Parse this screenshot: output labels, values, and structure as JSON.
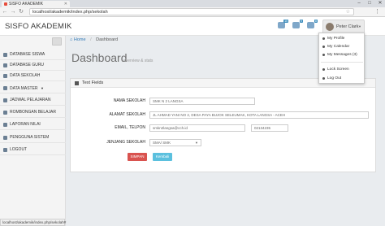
{
  "browser": {
    "tab_title": "SISFO AKADEMIK",
    "url": "localhost/akademik/index.php/sekolah",
    "status_url": "localhost/akademik/index.php/sekolah#"
  },
  "header": {
    "brand": "SISFO AKADEMIK",
    "notifications": [
      "10",
      "9",
      "8"
    ],
    "user_name": "Peter Clark"
  },
  "user_menu": {
    "items": [
      {
        "label": "My Profile",
        "icon": "user-icon"
      },
      {
        "label": "My Calendar",
        "icon": "calendar-icon"
      },
      {
        "label": "My Messages (3)",
        "icon": "envelope-icon"
      },
      {
        "label": "Lock Screen",
        "icon": "lock-icon"
      },
      {
        "label": "Log Out",
        "icon": "key-icon"
      }
    ]
  },
  "sidebar": {
    "items": [
      {
        "label": "DATABASE SISWA",
        "icon": "users-icon"
      },
      {
        "label": "DATABASE GURU",
        "icon": "graduation-cap-icon"
      },
      {
        "label": "DATA SEKOLAH",
        "icon": "building-icon"
      },
      {
        "label": "DATA MASTER",
        "icon": "database-icon",
        "has_caret": true
      },
      {
        "label": "JADWAL PELAJARAN",
        "icon": "calendar-icon"
      },
      {
        "label": "ROMBONGAN BELAJAR",
        "icon": "group-icon"
      },
      {
        "label": "LAPORAN NILAI",
        "icon": "file-icon"
      },
      {
        "label": "PENGGUNA SISTEM",
        "icon": "user-cog-icon"
      },
      {
        "label": "LOGOUT",
        "icon": "logout-icon"
      }
    ]
  },
  "breadcrumb": {
    "home": "Home",
    "current": "Dashboard"
  },
  "page": {
    "title": "Dashboard",
    "subtitle": "overview & stats"
  },
  "form": {
    "panel_title": "Text Fields",
    "labels": {
      "nama": "NAMA SEKOLAH",
      "alamat": "ALAMAT SEKOLAH",
      "email": "EMAIL, TELPON",
      "jenjang": "JENJANG SEKOLAH"
    },
    "values": {
      "nama": "SMK N 2 LANGSA",
      "alamat": "JL AHMAD YANI NO 2, DESA PAYA BUJOK SELEUMAK, KOTA LANGSA - ACEH",
      "email": "smkn2langsa@cch.id",
      "telpon": "02134235",
      "jenjang": "SMA/ SMK"
    },
    "buttons": {
      "save": "SIMPAN",
      "back": "Kembali"
    }
  },
  "colors": {
    "accent": "#3c8dbc",
    "save_button": "#d9534f",
    "back_button": "#5bc0de"
  }
}
